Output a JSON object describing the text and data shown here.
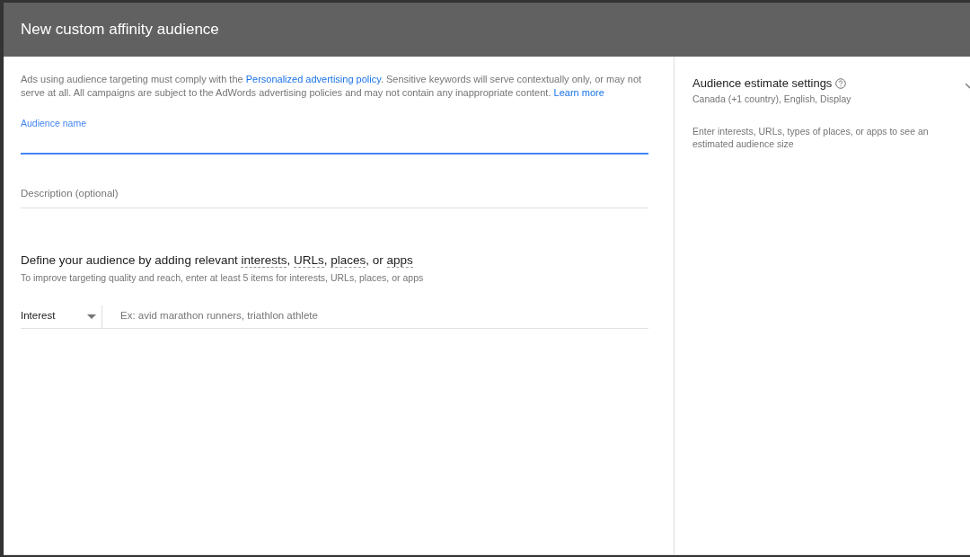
{
  "dialog": {
    "title": "New custom affinity audience"
  },
  "notice": {
    "parts": [
      {
        "kind": "text",
        "text": "Ads using audience targeting must comply with the "
      },
      {
        "kind": "link",
        "text": "Personalized advertising policy"
      },
      {
        "kind": "text",
        "text": ". Sensitive keywords will serve contextually only, or may not serve at all. All campaigns are subject to the AdWords advertising policies and may not contain any inappropriate content. "
      },
      {
        "kind": "link",
        "text": "Learn more"
      }
    ]
  },
  "fields": [
    {
      "label": "Audience name",
      "focused": true
    },
    {
      "placeholder": "Description (optional)",
      "focused": false
    }
  ],
  "define": {
    "heading": [
      {
        "kind": "text",
        "text": "Define your audience by adding relevant "
      },
      {
        "kind": "term",
        "text": "interests"
      },
      {
        "kind": "text",
        "text": ", "
      },
      {
        "kind": "term",
        "text": "URLs"
      },
      {
        "kind": "text",
        "text": ", "
      },
      {
        "kind": "term",
        "text": "places"
      },
      {
        "kind": "text",
        "text": ", or "
      },
      {
        "kind": "term",
        "text": "apps"
      }
    ],
    "hint": "To improve targeting quality and reach, enter at least 5 items for interests, URLs, places, or apps",
    "type_select": "Interest",
    "entry_placeholder": "Ex: avid marathon runners, triathlon athlete"
  },
  "estimate": {
    "title": "Audience estimate settings",
    "summary": "Canada (+1 country), English, Display",
    "message": "Enter interests, URLs, types of places, or apps to see an estimated audience size"
  }
}
